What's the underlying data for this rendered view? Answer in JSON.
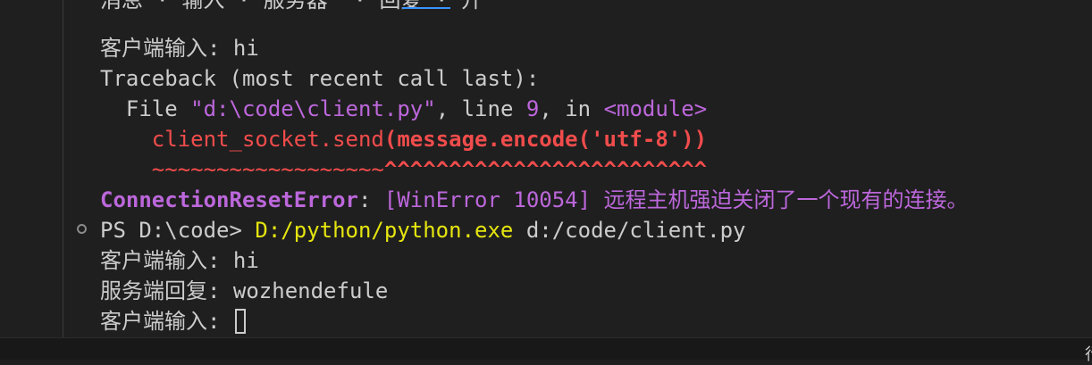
{
  "terminal": {
    "cut_line_text": "消息 · 输入 · 服务器  · 回复 · 开",
    "lines": {
      "client_input_1_label": "客户端输入: ",
      "client_input_1_value": "hi",
      "traceback_header": "Traceback (most recent call last):",
      "file_prefix": "  File ",
      "file_path": "\"d:\\code\\client.py\"",
      "file_middle": ", line ",
      "file_line_no": "9",
      "file_in": ", in ",
      "file_module": "<module>",
      "code_call": "    client_socket.send",
      "code_args": "(message.encode('utf-8'))",
      "squiggle_tilde": "    ~~~~~~~~~~~~~~~~~~",
      "squiggle_caret": "^^^^^^^^^^^^^^^^^^^^^^^^^",
      "error_name": "ConnectionResetError",
      "error_colon": ": ",
      "error_message": "[WinError 10054] 远程主机强迫关闭了一个现有的连接。",
      "prompt": "PS D:\\code> ",
      "command_exe": "D:/python/python.exe",
      "command_arg": " d:/code/client.py",
      "client_input_2_label": "客户端输入: ",
      "client_input_2_value": "hi",
      "server_reply_label": "服务端回复: ",
      "server_reply_value": "wozhendefule",
      "client_input_3_label": "客户端输入: "
    }
  },
  "status_bar": {
    "fragment": "行"
  },
  "colors": {
    "background": "#1f1f1f",
    "text": "#cccccc",
    "error_red": "#f14c4c",
    "magenta": "#bc67db",
    "command_yellow": "#e5e510"
  }
}
